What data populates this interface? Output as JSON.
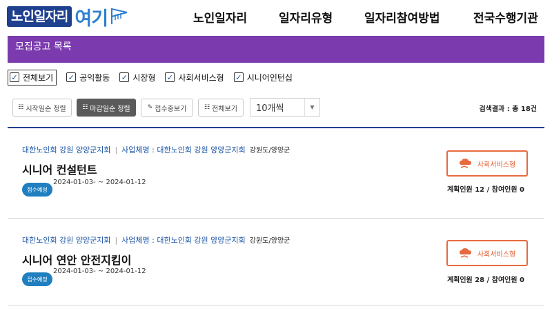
{
  "header": {
    "logo_main": "노인일자리",
    "logo_accent": "여기",
    "nav": [
      "노인일자리",
      "일자리유형",
      "일자리참여방법",
      "전국수행기관"
    ]
  },
  "list_title": "모집공고 목록",
  "filters": [
    {
      "label": "전체보기",
      "checked": true
    },
    {
      "label": "공익활동",
      "checked": true
    },
    {
      "label": "시장형",
      "checked": true
    },
    {
      "label": "사회서비스형",
      "checked": true
    },
    {
      "label": "시니어인턴십",
      "checked": true
    }
  ],
  "toolbar": {
    "sort_start": "시작일순 정렬",
    "sort_deadline": "마감일순 정렬",
    "view_open": "접수중보기",
    "view_all": "전체보기",
    "page_size": "10개씩",
    "result_text": "검색결과 : 총 18건"
  },
  "colors": {
    "brand_purple": "#7b3aae",
    "brand_blue": "#1f3f8f",
    "accent_orange": "#e8693e",
    "badge_blue": "#1f7fc0"
  },
  "jobs": [
    {
      "org": "대한노인회 강원 양양군지회",
      "business": "사업체명 : 대한노인회 강원 양양군지회",
      "region": "강원도/양양군",
      "title": "시니어 컨설턴트",
      "status": "접수예정",
      "period": "2024-01-03- ~ 2024-01-12",
      "type": "사회서비스형",
      "counts": "계획인원 12 / 참여인원 0"
    },
    {
      "org": "대한노인회 강원 양양군지회",
      "business": "사업체명 : 대한노인회 강원 양양군지회",
      "region": "강원도/양양군",
      "title": "시니어 연안 안전지킴이",
      "status": "접수예정",
      "period": "2024-01-03- ~ 2024-01-12",
      "type": "사회서비스형",
      "counts": "계획인원 28 / 참여인원 0"
    }
  ]
}
